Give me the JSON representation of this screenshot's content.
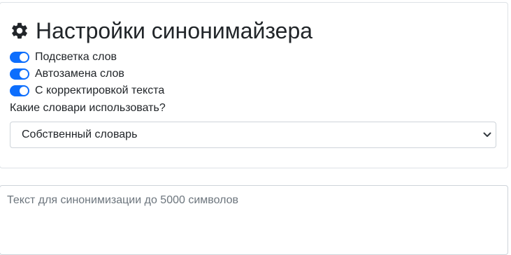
{
  "settings": {
    "title": "Настройки синонимайзера",
    "title_icon": "gear-icon",
    "switches": [
      {
        "label": "Подсветка слов",
        "checked": true
      },
      {
        "label": "Автозамена слов",
        "checked": true
      },
      {
        "label": "С корректировкой текста",
        "checked": true
      }
    ],
    "dictionary_question": "Какие словари использовать?",
    "dictionary_selected": "Собственный словарь",
    "accent_color": "#0d6efd"
  },
  "editor": {
    "placeholder": "Текст для синонимизации до 5000 символов"
  }
}
